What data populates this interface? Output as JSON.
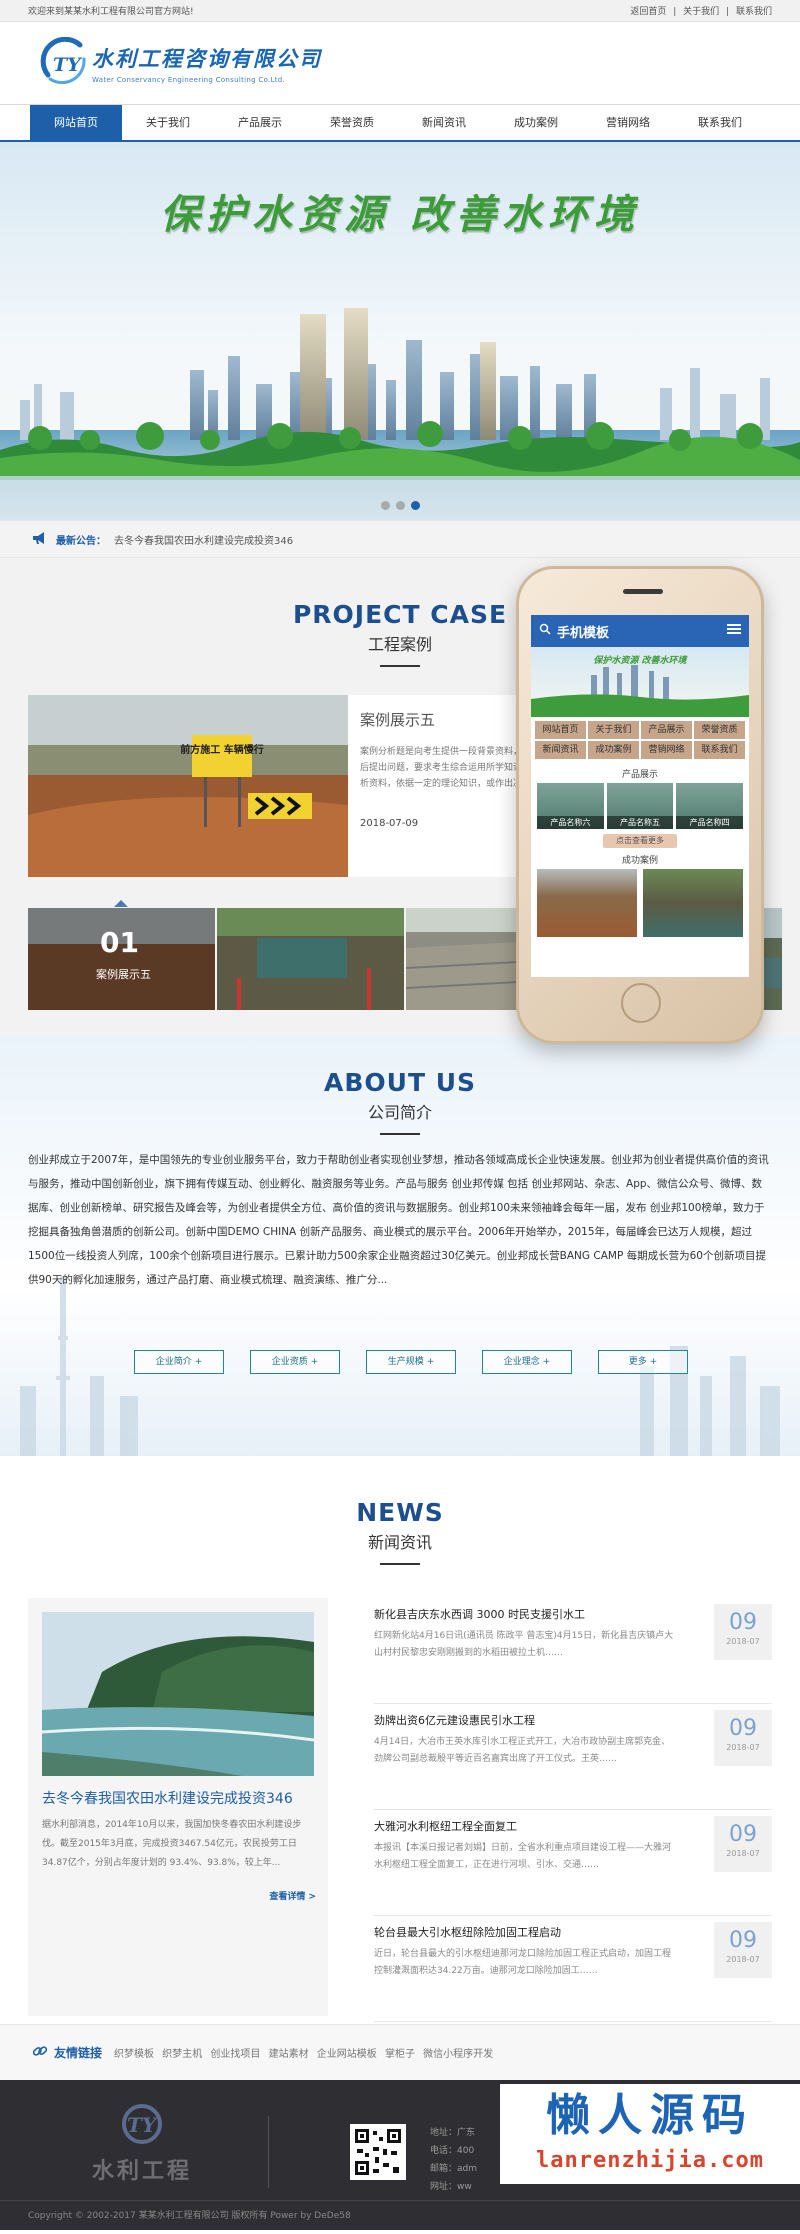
{
  "topbar": {
    "welcome": "欢迎来到某某水利工程有限公司官方网站!",
    "links": [
      "返回首页",
      "|",
      "关于我们",
      "|",
      "联系我们"
    ]
  },
  "logo": {
    "mark": "TY",
    "title": "水利工程咨询有限公司",
    "subtitle": "Water Conservancy Engineering Consulting Co.Ltd."
  },
  "nav": [
    "网站首页",
    "关于我们",
    "产品展示",
    "荣誉资质",
    "新闻资讯",
    "成功案例",
    "营销网络",
    "联系我们"
  ],
  "banner": {
    "slogan": "保护水资源  改善水环境"
  },
  "notice": {
    "label": "最新公告：",
    "text": "去冬今春我国农田水利建设完成投资346"
  },
  "project": {
    "title_en": "PROJECT CASE",
    "title_cn": "工程案例",
    "case": {
      "title": "案例展示五",
      "desc": "案例分析题是向考生提供一段背景资料，然后提出问题，要求考生综合运用所学知识分析资料，依据一定的理论知识，或作出决策，或作出评价，或提出具体的解决问题的方法或意见等。",
      "date": "2018-07-09",
      "sign": "前方施工 车辆慢行"
    },
    "thumb": {
      "num": "01",
      "caption": "案例展示五"
    }
  },
  "phone": {
    "title": "手机模板",
    "banner_text": "保护水资源  改善水环境",
    "nav": [
      "网站首页",
      "关于我们",
      "产品展示",
      "荣誉资质",
      "新闻资讯",
      "成功案例",
      "营销网络",
      "联系我们"
    ],
    "products_label": "产品展示",
    "products": [
      "产品名称六",
      "产品名称五",
      "产品名称四"
    ],
    "more": "点击查看更多",
    "cases_label": "成功案例"
  },
  "about": {
    "title_en": "ABOUT US",
    "title_cn": "公司简介",
    "text": "创业邦成立于2007年，是中国领先的专业创业服务平台，致力于帮助创业者实现创业梦想，推动各领域高成长企业快速发展。创业邦为创业者提供高价值的资讯与服务，推动中国创新创业，旗下拥有传媒互动、创业孵化、融资服务等业务。产品与服务 创业邦传媒 包括 创业邦网站、杂志、App、微信公众号、微博、数据库、创业创新榜单、研究报告及峰会等，为创业者提供全方位、高价值的资讯与数据服务。创业邦100未来领袖峰会每年一届，发布 创业邦100榜单，致力于挖掘具备独角兽潜质的创新公司。创新中国DEMO CHINA 创新产品服务、商业模式的展示平台。2006年开始举办，2015年，每届峰会已达万人规模，超过1500位一线投资人列席，100余个创新项目进行展示。已累计助力500余家企业融资超过30亿美元。创业邦成长营BANG CAMP 每期成长营为60个创新项目提供90天的孵化加速服务，通过产品打磨、商业模式梳理、融资演练、推广分...",
    "buttons": [
      "企业简介 +",
      "企业资质 +",
      "生产规模 +",
      "企业理念 +",
      "更多 +"
    ]
  },
  "news": {
    "title_en": "NEWS",
    "title_cn": "新闻资讯",
    "feature": {
      "title": "去冬今春我国农田水利建设完成投资346",
      "desc": "据水利部消息，2014年10月以来，我国加快冬春农田水利建设步伐。截至2015年3月底，完成投资3467.54亿元，农民投劳工日34.87亿个，分别占年度计划的 93.4%、93.8%，较上年...",
      "more": "查看详情 >"
    },
    "items": [
      {
        "title": "新化县吉庆东水西调 3000 时民支援引水工",
        "desc": "红网新化站4月16日讯(通讯员 陈政平 曾志宝)4月15日，新化县吉庆镇卢大山村村民黎忠安刚刚搬到的水稻田被拉土机……",
        "day": "09",
        "ym": "2018-07"
      },
      {
        "title": "劲牌出资6亿元建设惠民引水工程",
        "desc": "4月14日，大冶市王英水库引水工程正式开工，大冶市政协副主席郭克金、劲牌公司副总裁殷平等近百名嘉宾出席了开工仪式。王英……",
        "day": "09",
        "ym": "2018-07"
      },
      {
        "title": "大雅河水利枢纽工程全面复工",
        "desc": "本报讯【本溪日报记者刘娟】日前，全省水利重点项目建设工程——大雅河水利枢纽工程全面复工，正在进行河坝、引水、交通……",
        "day": "09",
        "ym": "2018-07"
      },
      {
        "title": "轮台县最大引水枢纽除险加固工程启动",
        "desc": "近日，轮台县最大的引水枢纽迪那河龙口除险加固工程正式启动，加固工程控制灌溉面积达34.22万亩。迪那河龙口除险加固工……",
        "day": "09",
        "ym": "2018-07"
      }
    ]
  },
  "friend": {
    "label": "友情链接",
    "links": [
      "织梦模板",
      "织梦主机",
      "创业找项目",
      "建站素材",
      "企业网站模板",
      "掌柜子",
      "微信小程序开发"
    ]
  },
  "footer": {
    "logo_text": "水利工程",
    "info": [
      "地址：广东",
      "电话：400",
      "邮箱：adm",
      "网址：ww"
    ],
    "watermark_big": "懒人源码",
    "watermark_small": "lanrenzhijia.com",
    "copyright": "Copyright © 2002-2017 某某水利工程有限公司 版权所有 Power by DeDe58"
  }
}
